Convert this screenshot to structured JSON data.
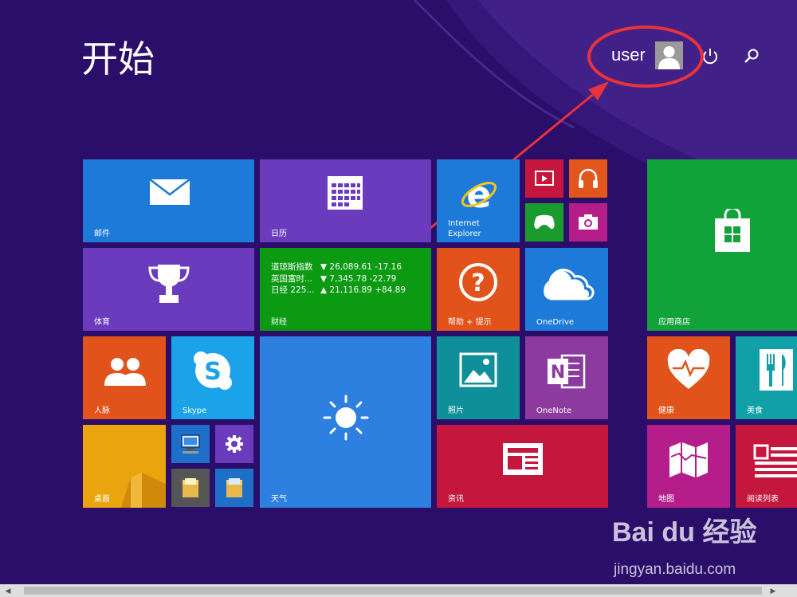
{
  "start_title": "开始",
  "user": {
    "name": "user"
  },
  "icons": {
    "power": "power-icon",
    "search": "search-icon"
  },
  "tiles": {
    "mail": "邮件",
    "calendar": "日历",
    "ie": "Internet Explorer",
    "ie_line1": "Internet",
    "ie_line2": "Explorer",
    "store": "应用商店",
    "sports": "体育",
    "finance": "财经",
    "help": "帮助 + 提示",
    "onedrive": "OneDrive",
    "people": "人脉",
    "skype": "Skype",
    "weather": "天气",
    "photos": "照片",
    "onenote": "OneNote",
    "health": "健康",
    "food": "美食",
    "desktop": "桌面",
    "news": "资讯",
    "maps": "地图",
    "reading": "阅读列表"
  },
  "finance_rows": [
    {
      "name": "道琼斯指数",
      "value": "▼ 26,089.61 -17.16"
    },
    {
      "name": "英国富时...",
      "value": "▼ 7,345.78 -22.79"
    },
    {
      "name": "日经 225...",
      "value": "▲ 21,116.89 +84.89"
    }
  ],
  "watermark": {
    "brand": "Bai du 经验",
    "url": "jingyan.baidu.com"
  },
  "colors": {
    "background": "#2b0e6a",
    "annotation": "#e8323c"
  }
}
